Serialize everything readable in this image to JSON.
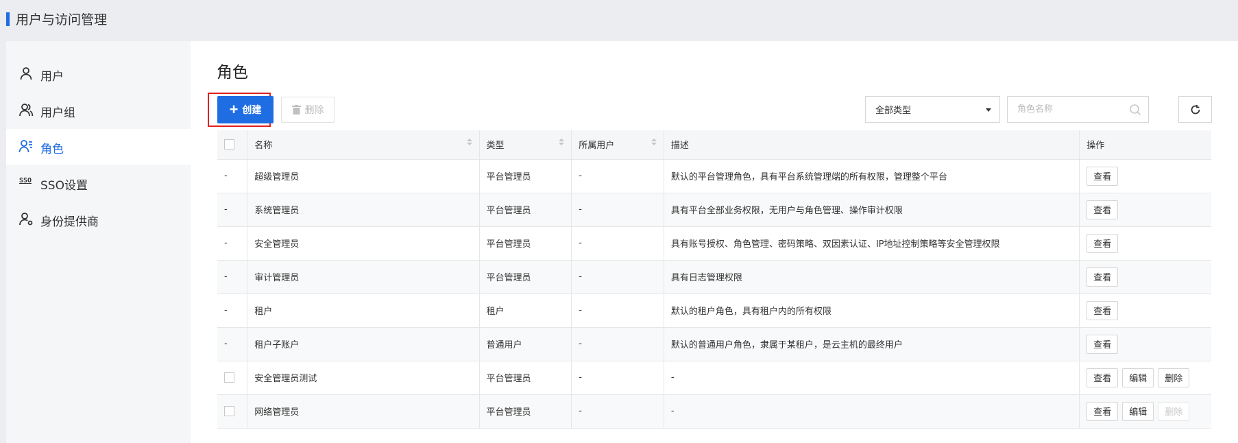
{
  "header": {
    "title": "用户与访问管理"
  },
  "sidebar": {
    "items": [
      {
        "label": "用户",
        "icon": "user-icon",
        "active": false
      },
      {
        "label": "用户组",
        "icon": "user-group-icon",
        "active": false
      },
      {
        "label": "角色",
        "icon": "role-icon",
        "active": true
      },
      {
        "label": "SSO设置",
        "icon": "sso-icon",
        "icon_text": "SSO",
        "active": false
      },
      {
        "label": "身份提供商",
        "icon": "identity-provider-icon",
        "active": false
      }
    ]
  },
  "main": {
    "title": "角色",
    "toolbar": {
      "create_label": "创建",
      "delete_label": "删除",
      "type_select_value": "全部类型",
      "search_placeholder": "角色名称"
    },
    "table": {
      "columns": [
        "名称",
        "类型",
        "所属用户",
        "描述",
        "操作"
      ],
      "rows": [
        {
          "selector": "-",
          "name": "超级管理员",
          "type": "平台管理员",
          "owner": "-",
          "desc": "默认的平台管理角色，具有平台系统管理端的所有权限，管理整个平台",
          "actions": [
            "查看"
          ]
        },
        {
          "selector": "-",
          "name": "系统管理员",
          "type": "平台管理员",
          "owner": "-",
          "desc": "具有平台全部业务权限，无用户与角色管理、操作审计权限",
          "actions": [
            "查看"
          ]
        },
        {
          "selector": "-",
          "name": "安全管理员",
          "type": "平台管理员",
          "owner": "-",
          "desc": "具有账号授权、角色管理、密码策略、双因素认证、IP地址控制策略等安全管理权限",
          "actions": [
            "查看"
          ]
        },
        {
          "selector": "-",
          "name": "审计管理员",
          "type": "平台管理员",
          "owner": "-",
          "desc": "具有日志管理权限",
          "actions": [
            "查看"
          ]
        },
        {
          "selector": "-",
          "name": "租户",
          "type": "租户",
          "owner": "-",
          "desc": "默认的租户角色，具有租户内的所有权限",
          "actions": [
            "查看"
          ]
        },
        {
          "selector": "-",
          "name": "租户子账户",
          "type": "普通用户",
          "owner": "-",
          "desc": "默认的普通用户角色，隶属于某租户，是云主机的最终用户",
          "actions": [
            "查看"
          ]
        },
        {
          "selector": "checkbox",
          "name": "安全管理员测试",
          "type": "平台管理员",
          "owner": "-",
          "desc": "-",
          "actions": [
            "查看",
            "编辑",
            "删除"
          ]
        },
        {
          "selector": "checkbox",
          "name": "网络管理员",
          "type": "平台管理员",
          "owner": "-",
          "desc": "-",
          "actions": [
            "查看",
            "编辑",
            "删除"
          ],
          "delete_disabled": true
        }
      ]
    }
  },
  "colors": {
    "accent": "#1f6de3",
    "highlight_border": "#e02020"
  }
}
